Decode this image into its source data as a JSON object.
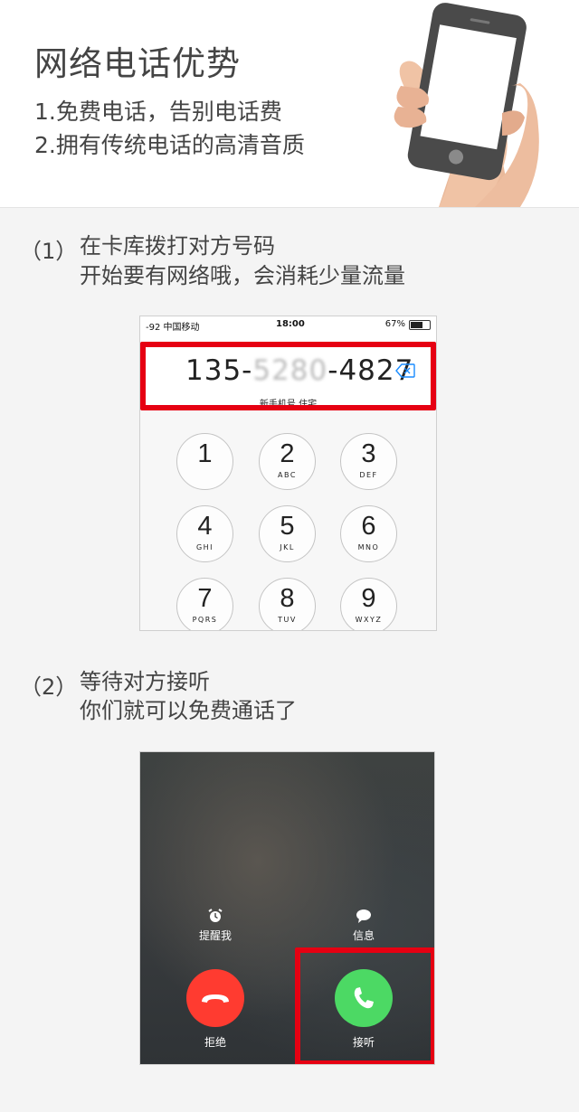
{
  "header": {
    "title": "网络电话优势",
    "line1": "1.免费电话，告别电话费",
    "line2": "2.拥有传统电话的高清音质"
  },
  "step1": {
    "num": "（1）",
    "line1": "在卡库拨打对方号码",
    "line2": "开始要有网络哦，会消耗少量流量"
  },
  "dialer": {
    "status": {
      "signal": "-92 中国移动",
      "time": "18:00",
      "battery": "67%",
      "battery_level": 0.67
    },
    "number_prefix": "135-",
    "number_hidden": "5280",
    "number_suffix": "-4827",
    "caller_label": "新手机号 住宅",
    "keys": [
      {
        "digit": "1",
        "letters": ""
      },
      {
        "digit": "2",
        "letters": "ABC"
      },
      {
        "digit": "3",
        "letters": "DEF"
      },
      {
        "digit": "4",
        "letters": "GHI"
      },
      {
        "digit": "5",
        "letters": "JKL"
      },
      {
        "digit": "6",
        "letters": "MNO"
      },
      {
        "digit": "7",
        "letters": "PQRS"
      },
      {
        "digit": "8",
        "letters": "TUV"
      },
      {
        "digit": "9",
        "letters": "WXYZ"
      }
    ]
  },
  "step2": {
    "num": "（2）",
    "line1": "等待对方接听",
    "line2": "你们就可以免费通话了"
  },
  "incoming": {
    "remind_label": "提醒我",
    "message_label": "信息",
    "decline_label": "拒绝",
    "accept_label": "接听",
    "decline_color": "#ff3b30",
    "accept_color": "#4cd964"
  },
  "colors": {
    "highlight": "#e60012"
  }
}
